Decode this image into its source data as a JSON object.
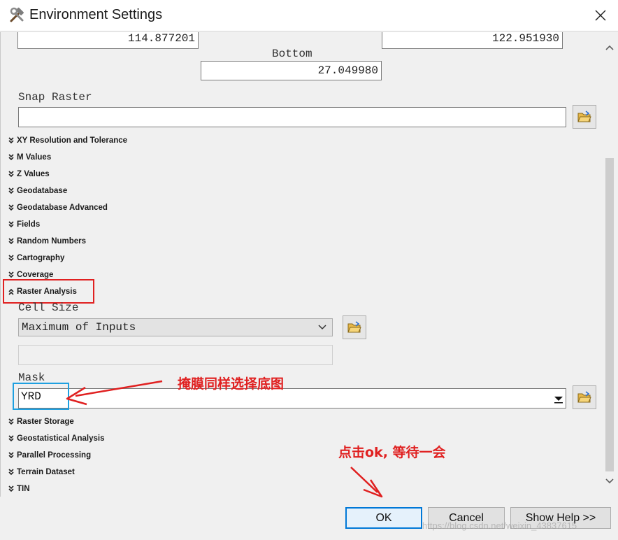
{
  "window": {
    "title": "Environment Settings",
    "icon": "hammer-wrench-icon"
  },
  "extent": {
    "left_value": "114.877201",
    "right_value": "122.951930",
    "bottom_label": "Bottom",
    "bottom_value": "27.049980"
  },
  "snap_raster": {
    "label": "Snap Raster",
    "value": ""
  },
  "sections_top": [
    "XY Resolution and Tolerance",
    "M Values",
    "Z Values",
    "Geodatabase",
    "Geodatabase Advanced",
    "Fields",
    "Random Numbers",
    "Cartography",
    "Coverage"
  ],
  "raster_analysis": {
    "label": "Raster Analysis",
    "cell_size_label": "Cell Size",
    "cell_size_value": "Maximum of Inputs",
    "mask_label": "Mask",
    "mask_value": "YRD"
  },
  "sections_bottom": [
    "Raster Storage",
    "Geostatistical Analysis",
    "Parallel Processing",
    "Terrain Dataset",
    "TIN"
  ],
  "buttons": {
    "ok": "OK",
    "cancel": "Cancel",
    "help": "Show Help >>"
  },
  "annotations": {
    "mask_note": "掩膜同样选择底图",
    "ok_note": "点击ok, 等待一会"
  },
  "watermark": "https://blog.csdn.net/weixin_43837615",
  "colors": {
    "annotation_red": "#e02020",
    "highlight_blue": "#1fa0e0",
    "primary_button_border": "#0078d7"
  }
}
